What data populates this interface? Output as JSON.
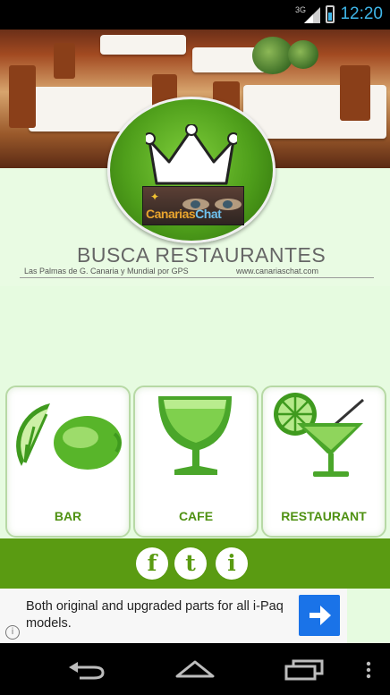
{
  "status_bar": {
    "network": "3G",
    "time": "12:20"
  },
  "header": {
    "logo_brand_part1": "Canarias",
    "logo_brand_part2": "Chat",
    "title": "BUSCA RESTAURANTES",
    "subtitle": "Las Palmas de G. Canaria y Mundial por GPS",
    "website": "www.canariaschat.com"
  },
  "categories": [
    {
      "label": "BAR",
      "icon": "lime-icon"
    },
    {
      "label": "CAFE",
      "icon": "glass-icon"
    },
    {
      "label": "RESTAURANT",
      "icon": "cocktail-icon"
    }
  ],
  "social": {
    "facebook": "f",
    "twitter": "t",
    "info": "i"
  },
  "ad": {
    "text": "Both original and upgraded parts for all i-Paq models.",
    "info_glyph": "i"
  },
  "colors": {
    "accent_green": "#5a9b12",
    "background": "#e6fbe0",
    "ad_button": "#1a73e8"
  }
}
